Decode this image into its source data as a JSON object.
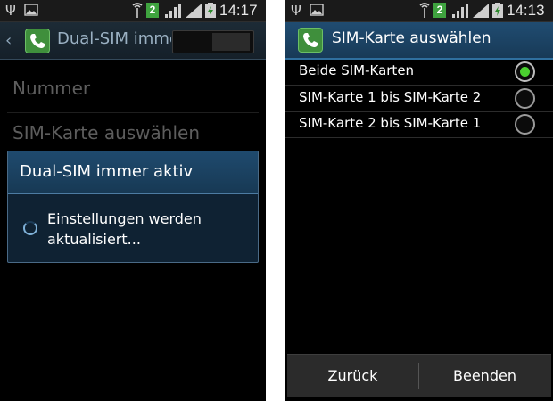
{
  "left_screen": {
    "status_bar": {
      "sim_badge": "2",
      "clock": "14:17",
      "icons": [
        "usb-icon",
        "image-icon",
        "antenna-icon",
        "signal-icon",
        "signal-icon",
        "battery-charging-icon"
      ]
    },
    "app_bar": {
      "title": "Dual-SIM imme",
      "icon": "phone-icon"
    },
    "settings_items": [
      {
        "label": "Nummer"
      },
      {
        "label": "SIM-Karte auswählen"
      }
    ],
    "dialog": {
      "title": "Dual-SIM immer aktiv",
      "message": "Einstellungen werden aktualisiert..."
    }
  },
  "right_screen": {
    "status_bar": {
      "sim_badge": "2",
      "clock": "14:13",
      "icons": [
        "usb-icon",
        "image-icon",
        "antenna-icon",
        "signal-icon",
        "signal-icon",
        "battery-charging-icon"
      ]
    },
    "title_bar": {
      "title": "SIM-Karte auswählen",
      "icon": "phone-icon"
    },
    "options": [
      {
        "label": "Beide SIM-Karten",
        "selected": true
      },
      {
        "label": "SIM-Karte 1 bis SIM-Karte 2",
        "selected": false
      },
      {
        "label": "SIM-Karte 2 bis SIM-Karte 1",
        "selected": false
      }
    ],
    "buttons": {
      "back": "Zurück",
      "finish": "Beenden"
    }
  },
  "colors": {
    "accent_green": "#4ad12f",
    "header_blue": "#204c71",
    "sim_badge_green": "#3fa33f"
  }
}
